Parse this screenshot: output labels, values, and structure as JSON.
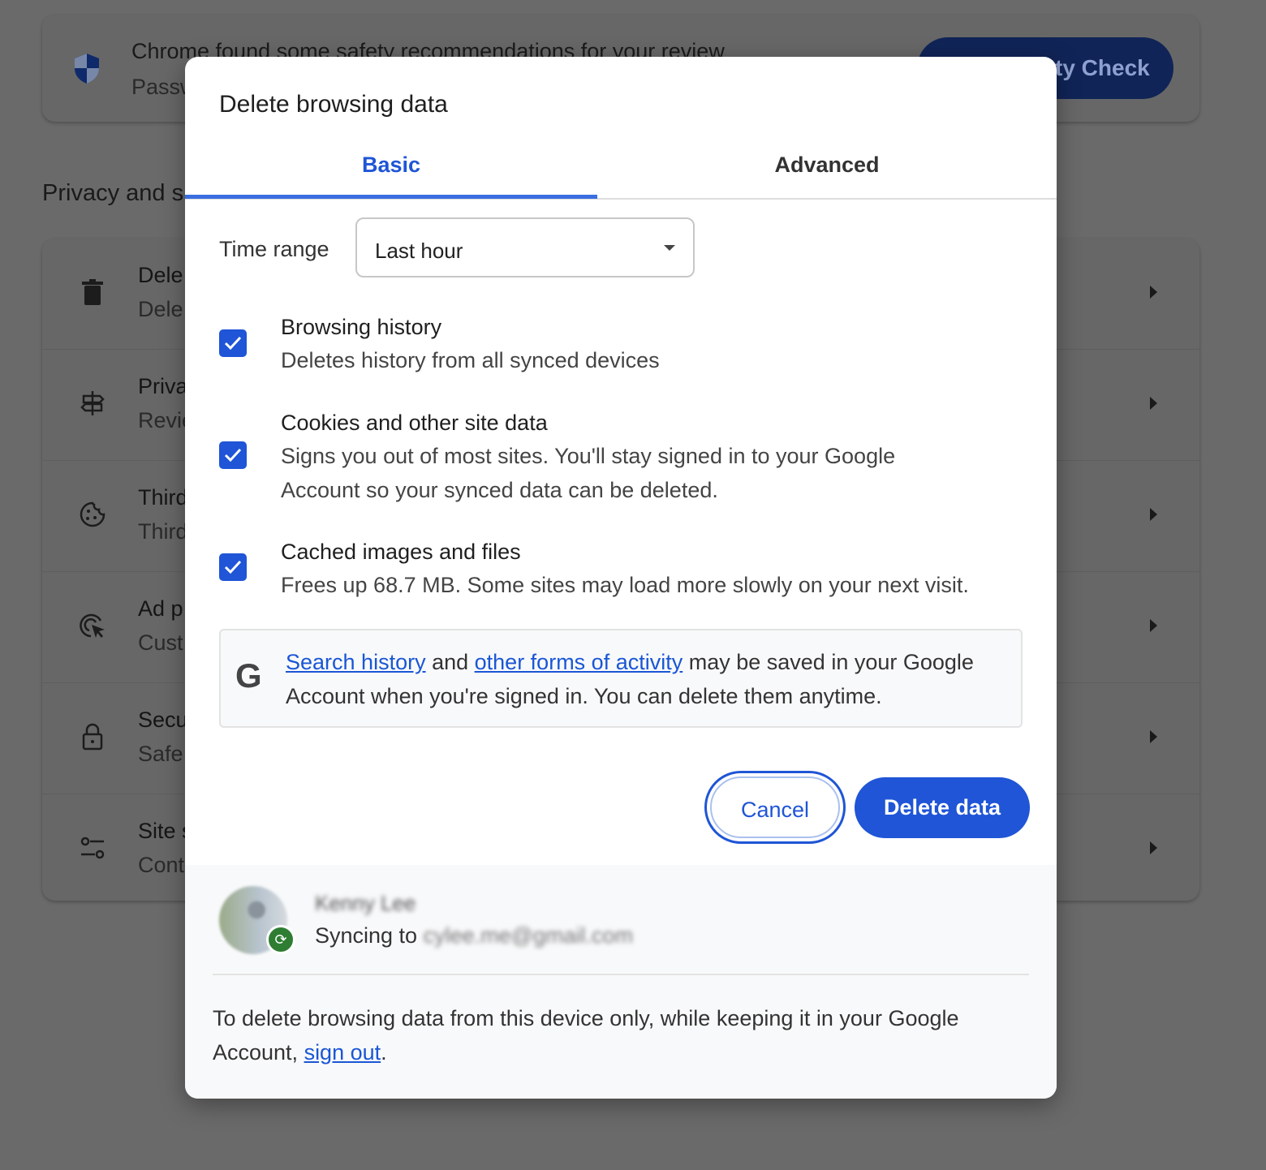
{
  "background": {
    "banner": {
      "title": "Chrome found some safety recommendations for your review",
      "subtitle": "Passw",
      "button": "ty Check"
    },
    "section_title": "Privacy and s",
    "rows": [
      {
        "icon": "trash-icon",
        "title": "Dele",
        "subtitle": "Dele"
      },
      {
        "icon": "signpost-icon",
        "title": "Priva",
        "subtitle": "Revie"
      },
      {
        "icon": "cookie-icon",
        "title": "Third",
        "subtitle": "Third"
      },
      {
        "icon": "ad-target-icon",
        "title": "Ad p",
        "subtitle": "Cust"
      },
      {
        "icon": "lock-icon",
        "title": "Secu",
        "subtitle": "Safe"
      },
      {
        "icon": "sliders-icon",
        "title": "Site s",
        "subtitle": "Cont"
      }
    ]
  },
  "dialog": {
    "title": "Delete browsing data",
    "tabs": [
      {
        "label": "Basic",
        "active": true
      },
      {
        "label": "Advanced",
        "active": false
      }
    ],
    "time_range": {
      "label": "Time range",
      "value": "Last hour"
    },
    "options": [
      {
        "title": "Browsing history",
        "desc": "Deletes history from all synced devices",
        "checked": true
      },
      {
        "title": "Cookies and other site data",
        "desc": "Signs you out of most sites. You'll stay signed in to your Google Account so your synced data can be deleted.",
        "checked": true
      },
      {
        "title": "Cached images and files",
        "desc": "Frees up 68.7 MB. Some sites may load more slowly on your next visit.",
        "checked": true
      }
    ],
    "info": {
      "link1": "Search history",
      "and": " and ",
      "link2": "other forms of activity",
      "rest": " may be saved in your Google Account when you're signed in. You can delete them anytime."
    },
    "cancel": "Cancel",
    "delete": "Delete data",
    "account": {
      "name": "Kenny Lee",
      "syncing": "Syncing to ",
      "email": "cylee.me@gmail.com"
    },
    "footer": {
      "text": "To delete browsing data from this device only, while keeping it in your Google Account, ",
      "link": "sign out",
      "end": "."
    },
    "colors": {
      "accent": "#1f55d6",
      "sync_badge": "#2e7d32"
    }
  }
}
